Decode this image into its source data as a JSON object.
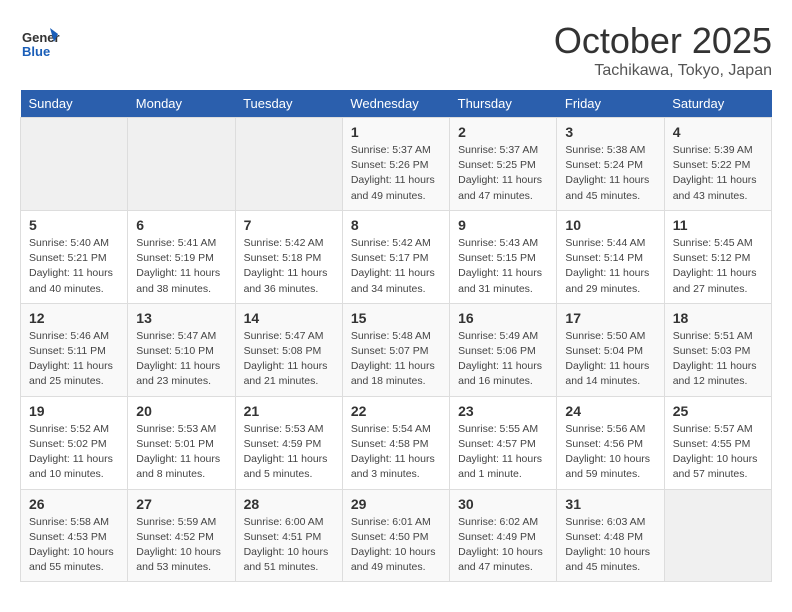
{
  "header": {
    "logo_general": "General",
    "logo_blue": "Blue",
    "month_title": "October 2025",
    "location": "Tachikawa, Tokyo, Japan"
  },
  "days_of_week": [
    "Sunday",
    "Monday",
    "Tuesday",
    "Wednesday",
    "Thursday",
    "Friday",
    "Saturday"
  ],
  "weeks": [
    [
      {
        "day": "",
        "info": ""
      },
      {
        "day": "",
        "info": ""
      },
      {
        "day": "",
        "info": ""
      },
      {
        "day": "1",
        "info": "Sunrise: 5:37 AM\nSunset: 5:26 PM\nDaylight: 11 hours\nand 49 minutes."
      },
      {
        "day": "2",
        "info": "Sunrise: 5:37 AM\nSunset: 5:25 PM\nDaylight: 11 hours\nand 47 minutes."
      },
      {
        "day": "3",
        "info": "Sunrise: 5:38 AM\nSunset: 5:24 PM\nDaylight: 11 hours\nand 45 minutes."
      },
      {
        "day": "4",
        "info": "Sunrise: 5:39 AM\nSunset: 5:22 PM\nDaylight: 11 hours\nand 43 minutes."
      }
    ],
    [
      {
        "day": "5",
        "info": "Sunrise: 5:40 AM\nSunset: 5:21 PM\nDaylight: 11 hours\nand 40 minutes."
      },
      {
        "day": "6",
        "info": "Sunrise: 5:41 AM\nSunset: 5:19 PM\nDaylight: 11 hours\nand 38 minutes."
      },
      {
        "day": "7",
        "info": "Sunrise: 5:42 AM\nSunset: 5:18 PM\nDaylight: 11 hours\nand 36 minutes."
      },
      {
        "day": "8",
        "info": "Sunrise: 5:42 AM\nSunset: 5:17 PM\nDaylight: 11 hours\nand 34 minutes."
      },
      {
        "day": "9",
        "info": "Sunrise: 5:43 AM\nSunset: 5:15 PM\nDaylight: 11 hours\nand 31 minutes."
      },
      {
        "day": "10",
        "info": "Sunrise: 5:44 AM\nSunset: 5:14 PM\nDaylight: 11 hours\nand 29 minutes."
      },
      {
        "day": "11",
        "info": "Sunrise: 5:45 AM\nSunset: 5:12 PM\nDaylight: 11 hours\nand 27 minutes."
      }
    ],
    [
      {
        "day": "12",
        "info": "Sunrise: 5:46 AM\nSunset: 5:11 PM\nDaylight: 11 hours\nand 25 minutes."
      },
      {
        "day": "13",
        "info": "Sunrise: 5:47 AM\nSunset: 5:10 PM\nDaylight: 11 hours\nand 23 minutes."
      },
      {
        "day": "14",
        "info": "Sunrise: 5:47 AM\nSunset: 5:08 PM\nDaylight: 11 hours\nand 21 minutes."
      },
      {
        "day": "15",
        "info": "Sunrise: 5:48 AM\nSunset: 5:07 PM\nDaylight: 11 hours\nand 18 minutes."
      },
      {
        "day": "16",
        "info": "Sunrise: 5:49 AM\nSunset: 5:06 PM\nDaylight: 11 hours\nand 16 minutes."
      },
      {
        "day": "17",
        "info": "Sunrise: 5:50 AM\nSunset: 5:04 PM\nDaylight: 11 hours\nand 14 minutes."
      },
      {
        "day": "18",
        "info": "Sunrise: 5:51 AM\nSunset: 5:03 PM\nDaylight: 11 hours\nand 12 minutes."
      }
    ],
    [
      {
        "day": "19",
        "info": "Sunrise: 5:52 AM\nSunset: 5:02 PM\nDaylight: 11 hours\nand 10 minutes."
      },
      {
        "day": "20",
        "info": "Sunrise: 5:53 AM\nSunset: 5:01 PM\nDaylight: 11 hours\nand 8 minutes."
      },
      {
        "day": "21",
        "info": "Sunrise: 5:53 AM\nSunset: 4:59 PM\nDaylight: 11 hours\nand 5 minutes."
      },
      {
        "day": "22",
        "info": "Sunrise: 5:54 AM\nSunset: 4:58 PM\nDaylight: 11 hours\nand 3 minutes."
      },
      {
        "day": "23",
        "info": "Sunrise: 5:55 AM\nSunset: 4:57 PM\nDaylight: 11 hours\nand 1 minute."
      },
      {
        "day": "24",
        "info": "Sunrise: 5:56 AM\nSunset: 4:56 PM\nDaylight: 10 hours\nand 59 minutes."
      },
      {
        "day": "25",
        "info": "Sunrise: 5:57 AM\nSunset: 4:55 PM\nDaylight: 10 hours\nand 57 minutes."
      }
    ],
    [
      {
        "day": "26",
        "info": "Sunrise: 5:58 AM\nSunset: 4:53 PM\nDaylight: 10 hours\nand 55 minutes."
      },
      {
        "day": "27",
        "info": "Sunrise: 5:59 AM\nSunset: 4:52 PM\nDaylight: 10 hours\nand 53 minutes."
      },
      {
        "day": "28",
        "info": "Sunrise: 6:00 AM\nSunset: 4:51 PM\nDaylight: 10 hours\nand 51 minutes."
      },
      {
        "day": "29",
        "info": "Sunrise: 6:01 AM\nSunset: 4:50 PM\nDaylight: 10 hours\nand 49 minutes."
      },
      {
        "day": "30",
        "info": "Sunrise: 6:02 AM\nSunset: 4:49 PM\nDaylight: 10 hours\nand 47 minutes."
      },
      {
        "day": "31",
        "info": "Sunrise: 6:03 AM\nSunset: 4:48 PM\nDaylight: 10 hours\nand 45 minutes."
      },
      {
        "day": "",
        "info": ""
      }
    ]
  ]
}
